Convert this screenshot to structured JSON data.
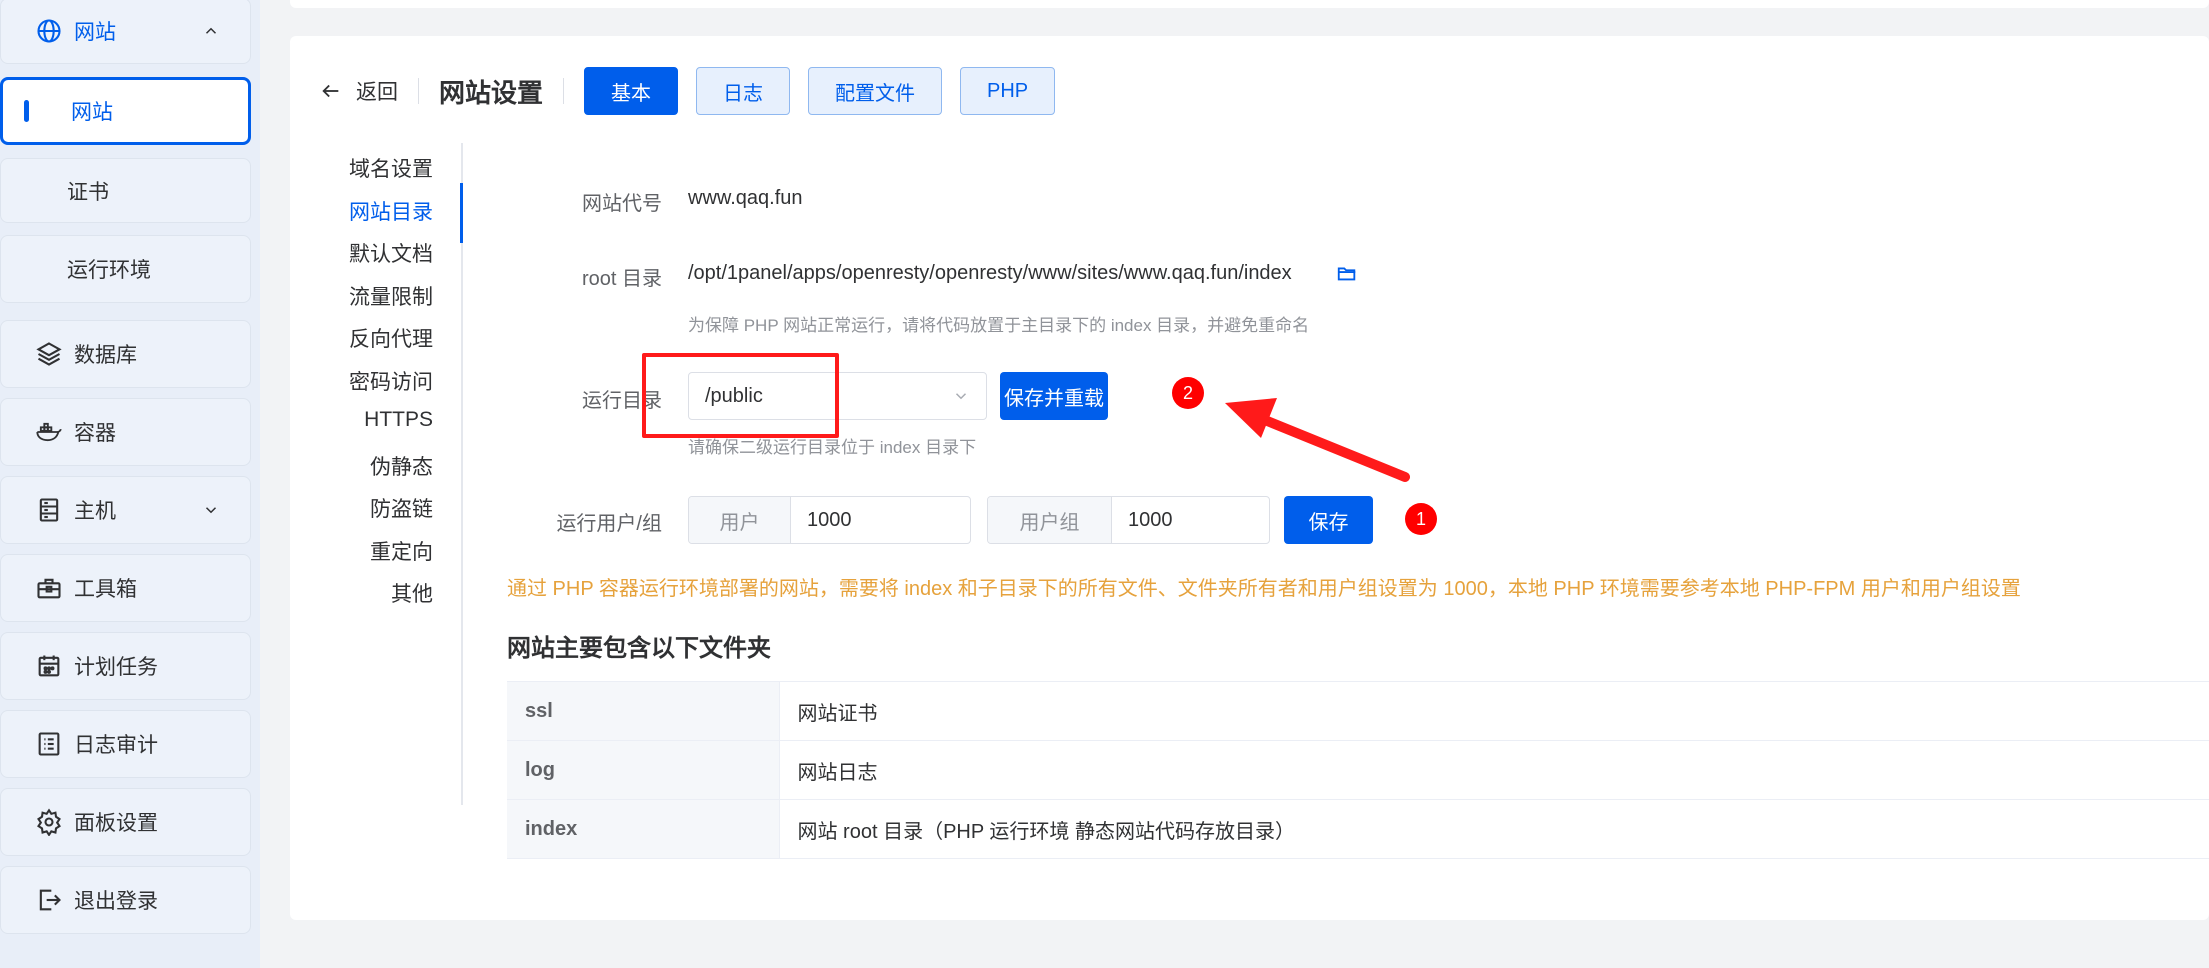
{
  "sidebar": {
    "website_group": {
      "label": "网站",
      "expanded": true
    },
    "sub_items": [
      {
        "label": "网站",
        "active": true
      },
      {
        "label": "证书",
        "active": false
      },
      {
        "label": "运行环境",
        "active": false
      }
    ],
    "items": [
      {
        "label": "数据库",
        "icon": "layers-icon"
      },
      {
        "label": "容器",
        "icon": "docker-icon"
      },
      {
        "label": "主机",
        "icon": "server-icon",
        "has_chevron": true
      },
      {
        "label": "工具箱",
        "icon": "toolbox-icon"
      },
      {
        "label": "计划任务",
        "icon": "calendar-icon"
      },
      {
        "label": "日志审计",
        "icon": "log-icon"
      },
      {
        "label": "面板设置",
        "icon": "gear-icon"
      },
      {
        "label": "退出登录",
        "icon": "logout-icon"
      }
    ]
  },
  "header": {
    "back_label": "返回",
    "title": "网站设置",
    "tabs": [
      {
        "label": "基本",
        "active": true
      },
      {
        "label": "日志",
        "active": false
      },
      {
        "label": "配置文件",
        "active": false
      },
      {
        "label": "PHP",
        "active": false
      }
    ]
  },
  "submenu": {
    "items": [
      {
        "label": "域名设置",
        "active": false
      },
      {
        "label": "网站目录",
        "active": true
      },
      {
        "label": "默认文档",
        "active": false
      },
      {
        "label": "流量限制",
        "active": false
      },
      {
        "label": "反向代理",
        "active": false
      },
      {
        "label": "密码访问",
        "active": false
      },
      {
        "label": "HTTPS",
        "active": false
      },
      {
        "label": "伪静态",
        "active": false
      },
      {
        "label": "防盗链",
        "active": false
      },
      {
        "label": "重定向",
        "active": false
      },
      {
        "label": "其他",
        "active": false
      }
    ]
  },
  "form": {
    "site_code": {
      "label": "网站代号",
      "value": "www.qaq.fun"
    },
    "root_dir": {
      "label": "root 目录",
      "value": "/opt/1panel/apps/openresty/openresty/www/sites/www.qaq.fun/index",
      "hint": "为保障 PHP 网站正常运行，请将代码放置于主目录下的 index 目录，并避免重命名"
    },
    "run_dir": {
      "label": "运行目录",
      "value": "/public",
      "button": "保存并重载",
      "hint": "请确保二级运行目录位于 index 目录下"
    },
    "run_user": {
      "label": "运行用户/组",
      "user_prefix": "用户",
      "user_value": "1000",
      "group_prefix": "用户组",
      "group_value": "1000",
      "button": "保存"
    },
    "warning": "通过 PHP 容器运行环境部署的网站，需要将 index 和子目录下的所有文件、文件夹所有者和用户组设置为 1000，本地 PHP 环境需要参考本地 PHP-FPM 用户和用户组设置"
  },
  "folders": {
    "title": "网站主要包含以下文件夹",
    "rows": [
      {
        "name": "ssl",
        "desc": "网站证书"
      },
      {
        "name": "log",
        "desc": "网站日志"
      },
      {
        "name": "index",
        "desc": "网站 root 目录（PHP 运行环境 静态网站代码存放目录）"
      }
    ]
  },
  "annotations": {
    "badge_1": "1",
    "badge_2": "2",
    "color": "#ff1a1a"
  },
  "colors": {
    "primary": "#005eeb",
    "warning": "#e6a23c",
    "sidebar_bg": "#e8eef8"
  }
}
